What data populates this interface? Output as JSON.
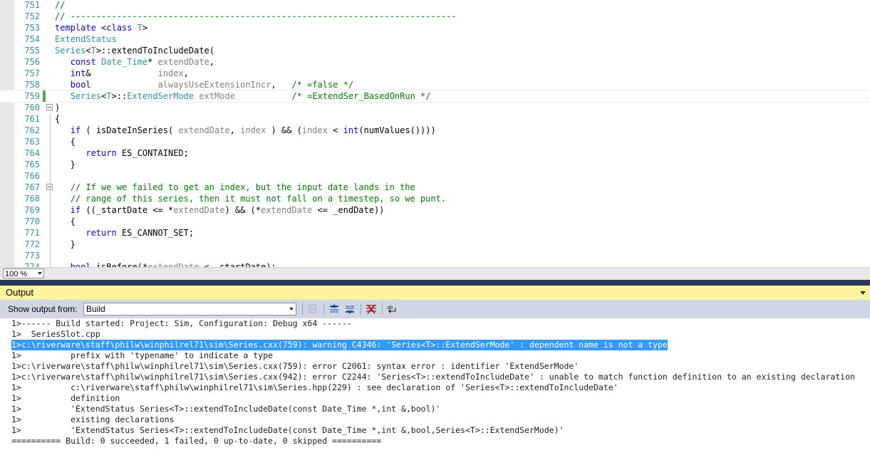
{
  "editor": {
    "lines": [
      {
        "num": "751",
        "segs": [
          {
            "c": "cm",
            "t": "//"
          }
        ]
      },
      {
        "num": "752",
        "segs": [
          {
            "c": "cm",
            "t": "// ---------------------------------------------------------------------------"
          }
        ]
      },
      {
        "num": "753",
        "segs": [
          {
            "c": "kw",
            "t": "template"
          },
          {
            "c": "",
            "t": " <"
          },
          {
            "c": "kw",
            "t": "class"
          },
          {
            "c": "",
            "t": " "
          },
          {
            "c": "ty",
            "t": "T"
          },
          {
            "c": "",
            "t": ">"
          }
        ]
      },
      {
        "num": "754",
        "segs": [
          {
            "c": "ty",
            "t": "ExtendStatus"
          }
        ]
      },
      {
        "num": "755",
        "segs": [
          {
            "c": "ty",
            "t": "Series"
          },
          {
            "c": "",
            "t": "<"
          },
          {
            "c": "ty",
            "t": "T"
          },
          {
            "c": "",
            "t": ">::extendToIncludeDate("
          }
        ]
      },
      {
        "num": "756",
        "segs": [
          {
            "c": "",
            "t": "   "
          },
          {
            "c": "kw",
            "t": "const"
          },
          {
            "c": "",
            "t": " "
          },
          {
            "c": "ty",
            "t": "Date_Time"
          },
          {
            "c": "",
            "t": "* "
          },
          {
            "c": "gr",
            "t": "extendDate"
          },
          {
            "c": "",
            "t": ","
          }
        ]
      },
      {
        "num": "757",
        "segs": [
          {
            "c": "",
            "t": "   "
          },
          {
            "c": "kw",
            "t": "int"
          },
          {
            "c": "",
            "t": "&             "
          },
          {
            "c": "gr",
            "t": "index"
          },
          {
            "c": "",
            "t": ","
          }
        ]
      },
      {
        "num": "758",
        "segs": [
          {
            "c": "",
            "t": "   "
          },
          {
            "c": "kw",
            "t": "bool"
          },
          {
            "c": "",
            "t": "             "
          },
          {
            "c": "gr",
            "t": "alwaysUseExtensionIncr"
          },
          {
            "c": "",
            "t": ",   "
          },
          {
            "c": "cm",
            "t": "/* =false */"
          }
        ]
      },
      {
        "num": "759",
        "segs": [
          {
            "c": "",
            "t": "   "
          },
          {
            "c": "ty",
            "t": "Series"
          },
          {
            "c": "",
            "t": "<"
          },
          {
            "c": "ty",
            "t": "T"
          },
          {
            "c": "",
            "t": ">::"
          },
          {
            "c": "ty",
            "t": "ExtendSerMode"
          },
          {
            "c": "",
            "t": " "
          },
          {
            "c": "gr",
            "t": "extMode"
          },
          {
            "c": "",
            "t": "           "
          },
          {
            "c": "cm",
            "t": "/* =ExtendSer_BasedOnRun */"
          }
        ]
      },
      {
        "num": "760",
        "segs": [
          {
            "c": "",
            "t": ")"
          }
        ]
      },
      {
        "num": "761",
        "segs": [
          {
            "c": "",
            "t": "{"
          }
        ]
      },
      {
        "num": "762",
        "segs": [
          {
            "c": "",
            "t": "   "
          },
          {
            "c": "kw",
            "t": "if"
          },
          {
            "c": "",
            "t": " ( isDateInSeries( "
          },
          {
            "c": "gr",
            "t": "extendDate"
          },
          {
            "c": "",
            "t": ", "
          },
          {
            "c": "gr",
            "t": "index"
          },
          {
            "c": "",
            "t": " ) && ("
          },
          {
            "c": "gr",
            "t": "index"
          },
          {
            "c": "",
            "t": " < "
          },
          {
            "c": "kw",
            "t": "int"
          },
          {
            "c": "",
            "t": "(numValues())))"
          }
        ]
      },
      {
        "num": "763",
        "segs": [
          {
            "c": "",
            "t": "   {"
          }
        ]
      },
      {
        "num": "764",
        "segs": [
          {
            "c": "",
            "t": "      "
          },
          {
            "c": "kw",
            "t": "return"
          },
          {
            "c": "",
            "t": " ES_CONTAINED;"
          }
        ]
      },
      {
        "num": "765",
        "segs": [
          {
            "c": "",
            "t": "   }"
          }
        ]
      },
      {
        "num": "766",
        "segs": []
      },
      {
        "num": "767",
        "segs": [
          {
            "c": "",
            "t": "   "
          },
          {
            "c": "cm",
            "t": "// If we we failed to get an index, but the input date lands in the"
          }
        ]
      },
      {
        "num": "768",
        "segs": [
          {
            "c": "",
            "t": "   "
          },
          {
            "c": "cm",
            "t": "// range of this series, then it must not fall on a timestep, so we punt."
          }
        ]
      },
      {
        "num": "769",
        "segs": [
          {
            "c": "",
            "t": "   "
          },
          {
            "c": "kw",
            "t": "if"
          },
          {
            "c": "",
            "t": " ((_startDate <= *"
          },
          {
            "c": "gr",
            "t": "extendDate"
          },
          {
            "c": "",
            "t": ") && (*"
          },
          {
            "c": "gr",
            "t": "extendDate"
          },
          {
            "c": "",
            "t": " <= _endDate))"
          }
        ]
      },
      {
        "num": "770",
        "segs": [
          {
            "c": "",
            "t": "   {"
          }
        ]
      },
      {
        "num": "771",
        "segs": [
          {
            "c": "",
            "t": "      "
          },
          {
            "c": "kw",
            "t": "return"
          },
          {
            "c": "",
            "t": " ES_CANNOT_SET;"
          }
        ]
      },
      {
        "num": "772",
        "segs": [
          {
            "c": "",
            "t": "   }"
          }
        ]
      },
      {
        "num": "773",
        "segs": []
      },
      {
        "num": "774",
        "segs": [
          {
            "c": "",
            "t": "   "
          },
          {
            "c": "kw",
            "t": "bool"
          },
          {
            "c": "",
            "t": " isBefore(*"
          },
          {
            "c": "gr",
            "t": "extendDate"
          },
          {
            "c": "",
            "t": " < _startDate);"
          }
        ]
      }
    ],
    "zoom": "100 %"
  },
  "output": {
    "title": "Output",
    "show_from_label": "Show output from:",
    "source": "Build",
    "lines": [
      "1>------ Build started: Project: Sim, Configuration: Debug x64 ------",
      "1>  SeriesSlot.cpp",
      "1>c:\\riverware\\staff\\philw\\winphilrel71\\sim\\Series.cxx(759): warning C4346: 'Series<T>::ExtendSerMode' : dependent name is not a type",
      "1>          prefix with 'typename' to indicate a type",
      "1>c:\\riverware\\staff\\philw\\winphilrel71\\sim\\Series.cxx(759): error C2061: syntax error : identifier 'ExtendSerMode'",
      "1>c:\\riverware\\staff\\philw\\winphilrel71\\sim\\Series.cxx(942): error C2244: 'Series<T>::extendToIncludeDate' : unable to match function definition to an existing declaration",
      "1>          c:\\riverware\\staff\\philw\\winphilrel71\\sim\\Series.hpp(229) : see declaration of 'Series<T>::extendToIncludeDate'",
      "1>          definition",
      "1>          'ExtendStatus Series<T>::extendToIncludeDate(const Date_Time *,int &,bool)'",
      "1>          existing declarations",
      "1>          'ExtendStatus Series<T>::extendToIncludeDate(const Date_Time *,int &,bool,Series<T>::ExtendSerMode)'",
      "========== Build: 0 succeeded, 1 failed, 0 up-to-date, 0 skipped =========="
    ],
    "selected_line": 2
  },
  "colors": {
    "selection": "#3399ff",
    "output_title_bg": "#fff29d",
    "toolbar_bg": "#cfd6e5",
    "line_number": "#2b91af",
    "keyword": "#0000ff",
    "comment": "#008000"
  }
}
